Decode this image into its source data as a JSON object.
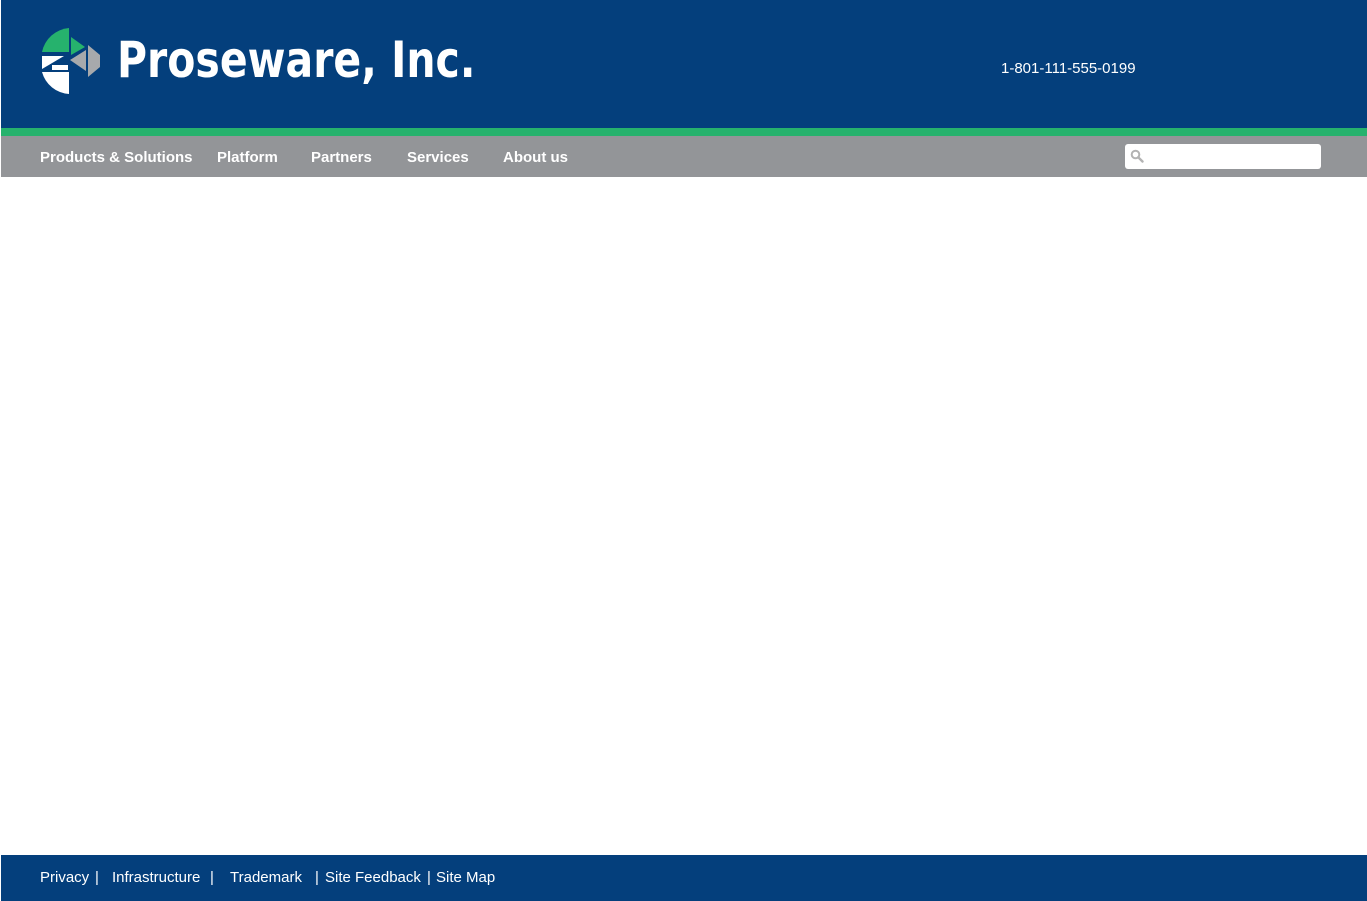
{
  "header": {
    "brand": "Proseware, Inc.",
    "phone": "1-801-111-555-0199",
    "logo_icon": "proseware-logo-icon"
  },
  "nav": {
    "items": [
      {
        "label": "Products & Solutions"
      },
      {
        "label": "Platform"
      },
      {
        "label": "Partners"
      },
      {
        "label": "Services"
      },
      {
        "label": "About us"
      }
    ],
    "search": {
      "placeholder": "",
      "value": "",
      "icon": "search-icon"
    }
  },
  "footer": {
    "links": [
      {
        "label": "Privacy"
      },
      {
        "label": "Infrastructure"
      },
      {
        "label": "Trademark"
      },
      {
        "label": "Site Feedback"
      },
      {
        "label": "Site Map"
      }
    ],
    "separator": "|"
  },
  "colors": {
    "primary_blue": "#043f7c",
    "accent_green": "#26b26d",
    "nav_gray": "#939598",
    "white": "#ffffff"
  }
}
